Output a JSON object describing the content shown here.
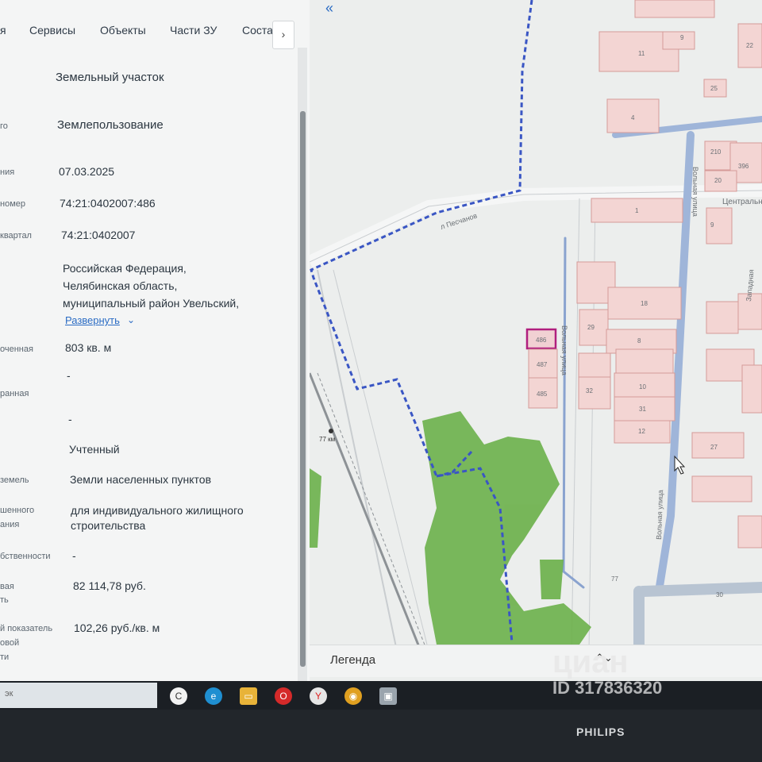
{
  "tabs": [
    "я",
    "Сервисы",
    "Объекты",
    "Части ЗУ",
    "Соста"
  ],
  "tab_arrow": "›",
  "collapse": "«",
  "rows": [
    {
      "label": "",
      "value": "Земельный участок"
    },
    {
      "label": "го",
      "value": "Землепользование"
    },
    {
      "label": "ния",
      "value": "07.03.2025"
    },
    {
      "label": "номер",
      "value": "74:21:0402007:486"
    },
    {
      "label": "квартал",
      "value": "74:21:0402007"
    },
    {
      "label": "",
      "value": ""
    },
    {
      "label": "оченная",
      "value": "803 кв. м"
    },
    {
      "label": "",
      "value": "-"
    },
    {
      "label": "ранная",
      "value": ""
    },
    {
      "label": "",
      "value": "-"
    },
    {
      "label": "",
      "value": "Учтенный"
    },
    {
      "label": "земель",
      "value": "Земли населенных пунктов"
    },
    {
      "label": "шенного",
      "value": ""
    },
    {
      "label": "ания",
      "value": ""
    },
    {
      "label": "бственности",
      "value": "-"
    },
    {
      "label": "вая",
      "value": "82 114,78 руб."
    },
    {
      "label": "ть",
      "value": ""
    },
    {
      "label": "й показатель",
      "value": "102,26 руб./кв. м"
    },
    {
      "label": "овой",
      "value": ""
    },
    {
      "label": "ти",
      "value": ""
    }
  ],
  "address": [
    "Российская Федерация,",
    "Челябинская область,",
    "муниципальный район Увельский,"
  ],
  "expand_label": "Развернуть",
  "usage": [
    "для индивидуального жилищного",
    "строительства"
  ],
  "legend_label": "Легенда",
  "legend_toggle": "⌃⌄",
  "map_labels": {
    "street_peschanaya": "л Песчанов",
    "street_volnaya_1": "Вольная улица",
    "street_volnaya_2": "Вольная улица",
    "street_volnaya_3": "Вольная улица",
    "street_central": "Центральн",
    "street_zapad": "Западная",
    "km_marker": "77 км",
    "parcel_486": "486",
    "parcel_487": "487",
    "parcel_485": "485",
    "p9a": "9",
    "p11": "11",
    "p4": "4",
    "p22": "22",
    "p25": "25",
    "p210": "210",
    "p396": "396",
    "p20": "20",
    "p1": "1",
    "p9b": "9",
    "p18": "18",
    "p29": "29",
    "p8": "8",
    "p10": "10",
    "p32": "32",
    "p31": "31",
    "p12": "12",
    "p27": "27",
    "p30": "30",
    "p77": "77"
  },
  "taskbar": {
    "search_hint": "эк"
  },
  "monitor_brand": "PHILIPS",
  "watermark": {
    "logo": "циан",
    "id": "ID 317836320"
  }
}
